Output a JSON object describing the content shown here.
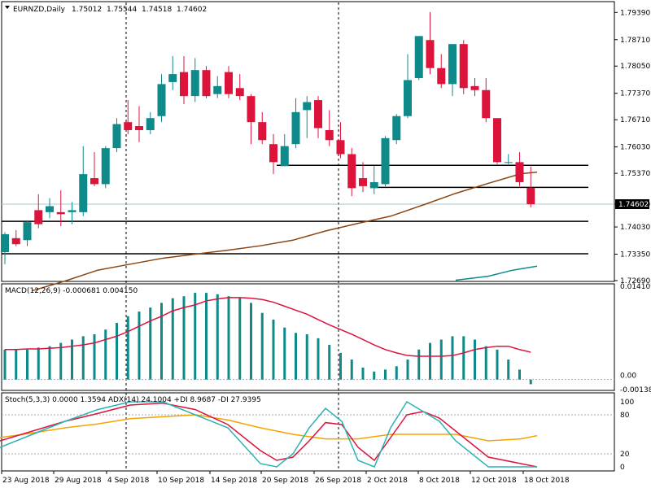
{
  "chart_data": {
    "type": "candlestick",
    "title": "EURNZD,Daily",
    "ohlc": [
      "1.75012",
      "1.75544",
      "1.74518",
      "1.74602"
    ],
    "current_price": "1.74602",
    "price_ylim": [
      1.7269,
      1.7964
    ],
    "price_ticks": [
      "1.79390",
      "1.78710",
      "1.78050",
      "1.77370",
      "1.76710",
      "1.76030",
      "1.75370",
      "1.74600",
      "1.74030",
      "1.73350",
      "1.72690"
    ],
    "candles": [
      {
        "o": 1.734,
        "h": 1.739,
        "l": 1.731,
        "c": 1.7385
      },
      {
        "o": 1.7375,
        "h": 1.7395,
        "l": 1.7355,
        "c": 1.736
      },
      {
        "o": 1.737,
        "h": 1.742,
        "l": 1.7355,
        "c": 1.7415
      },
      {
        "o": 1.7445,
        "h": 1.7485,
        "l": 1.74,
        "c": 1.741
      },
      {
        "o": 1.744,
        "h": 1.7475,
        "l": 1.7425,
        "c": 1.7455
      },
      {
        "o": 1.744,
        "h": 1.7495,
        "l": 1.7405,
        "c": 1.7435
      },
      {
        "o": 1.744,
        "h": 1.7465,
        "l": 1.741,
        "c": 1.7445
      },
      {
        "o": 1.744,
        "h": 1.7605,
        "l": 1.743,
        "c": 1.7535
      },
      {
        "o": 1.7525,
        "h": 1.759,
        "l": 1.7505,
        "c": 1.751
      },
      {
        "o": 1.751,
        "h": 1.7605,
        "l": 1.75,
        "c": 1.76
      },
      {
        "o": 1.76,
        "h": 1.7675,
        "l": 1.759,
        "c": 1.766
      },
      {
        "o": 1.7665,
        "h": 1.772,
        "l": 1.7635,
        "c": 1.7645
      },
      {
        "o": 1.7655,
        "h": 1.7705,
        "l": 1.7615,
        "c": 1.7645
      },
      {
        "o": 1.7645,
        "h": 1.769,
        "l": 1.7635,
        "c": 1.7675
      },
      {
        "o": 1.768,
        "h": 1.7785,
        "l": 1.7665,
        "c": 1.776
      },
      {
        "o": 1.7765,
        "h": 1.783,
        "l": 1.7745,
        "c": 1.7785
      },
      {
        "o": 1.779,
        "h": 1.783,
        "l": 1.771,
        "c": 1.773
      },
      {
        "o": 1.773,
        "h": 1.7825,
        "l": 1.7715,
        "c": 1.7795
      },
      {
        "o": 1.7795,
        "h": 1.7805,
        "l": 1.7725,
        "c": 1.773
      },
      {
        "o": 1.7735,
        "h": 1.778,
        "l": 1.7725,
        "c": 1.7755
      },
      {
        "o": 1.779,
        "h": 1.7805,
        "l": 1.7725,
        "c": 1.7735
      },
      {
        "o": 1.775,
        "h": 1.7785,
        "l": 1.772,
        "c": 1.773
      },
      {
        "o": 1.773,
        "h": 1.7735,
        "l": 1.761,
        "c": 1.7665
      },
      {
        "o": 1.7665,
        "h": 1.769,
        "l": 1.761,
        "c": 1.762
      },
      {
        "o": 1.761,
        "h": 1.7635,
        "l": 1.7535,
        "c": 1.7565
      },
      {
        "o": 1.7555,
        "h": 1.7635,
        "l": 1.7555,
        "c": 1.7605
      },
      {
        "o": 1.761,
        "h": 1.7725,
        "l": 1.76,
        "c": 1.769
      },
      {
        "o": 1.7695,
        "h": 1.773,
        "l": 1.7625,
        "c": 1.7715
      },
      {
        "o": 1.772,
        "h": 1.773,
        "l": 1.7625,
        "c": 1.765
      },
      {
        "o": 1.7645,
        "h": 1.7695,
        "l": 1.7605,
        "c": 1.762
      },
      {
        "o": 1.762,
        "h": 1.7665,
        "l": 1.7575,
        "c": 1.7585
      },
      {
        "o": 1.7585,
        "h": 1.76,
        "l": 1.748,
        "c": 1.75
      },
      {
        "o": 1.7525,
        "h": 1.7565,
        "l": 1.749,
        "c": 1.7505
      },
      {
        "o": 1.75,
        "h": 1.7555,
        "l": 1.7485,
        "c": 1.7515
      },
      {
        "o": 1.751,
        "h": 1.763,
        "l": 1.7505,
        "c": 1.7625
      },
      {
        "o": 1.762,
        "h": 1.7685,
        "l": 1.761,
        "c": 1.768
      },
      {
        "o": 1.768,
        "h": 1.7835,
        "l": 1.7675,
        "c": 1.777
      },
      {
        "o": 1.7775,
        "h": 1.788,
        "l": 1.777,
        "c": 1.788
      },
      {
        "o": 1.787,
        "h": 1.794,
        "l": 1.7785,
        "c": 1.78
      },
      {
        "o": 1.78,
        "h": 1.7835,
        "l": 1.775,
        "c": 1.776
      },
      {
        "o": 1.776,
        "h": 1.7825,
        "l": 1.773,
        "c": 1.786
      },
      {
        "o": 1.786,
        "h": 1.787,
        "l": 1.7735,
        "c": 1.775
      },
      {
        "o": 1.7755,
        "h": 1.7775,
        "l": 1.773,
        "c": 1.7745
      },
      {
        "o": 1.7745,
        "h": 1.7775,
        "l": 1.7665,
        "c": 1.7675
      },
      {
        "o": 1.7675,
        "h": 1.7675,
        "l": 1.756,
        "c": 1.7565
      },
      {
        "o": 1.7565,
        "h": 1.7585,
        "l": 1.756,
        "c": 1.7565
      },
      {
        "o": 1.7565,
        "h": 1.759,
        "l": 1.7505,
        "c": 1.7515
      },
      {
        "o": 1.7501,
        "h": 1.7554,
        "l": 1.7452,
        "c": 1.746
      }
    ],
    "ma_series": [
      [
        40,
        1.7244
      ],
      [
        80,
        1.7268
      ],
      [
        120,
        1.7295
      ],
      [
        160,
        1.731
      ],
      [
        200,
        1.7325
      ],
      [
        240,
        1.7335
      ],
      [
        280,
        1.7345
      ],
      [
        320,
        1.7356
      ],
      [
        360,
        1.737
      ],
      [
        400,
        1.7393
      ],
      [
        440,
        1.7412
      ],
      [
        480,
        1.743
      ],
      [
        520,
        1.7458
      ],
      [
        560,
        1.7487
      ],
      [
        600,
        1.7512
      ],
      [
        640,
        1.7536
      ],
      [
        660,
        1.754
      ]
    ],
    "ma2_series": [
      [
        560,
        1.727
      ],
      [
        600,
        1.728
      ],
      [
        630,
        1.7295
      ],
      [
        660,
        1.7305
      ]
    ],
    "hlines": [
      1.7557,
      1.7502,
      1.7417,
      1.7336
    ],
    "vlines_idx": [
      5,
      24
    ],
    "x_labels": [
      "23 Aug 2018",
      "29 Aug 2018",
      "4 Sep 2018",
      "10 Sep 2018",
      "14 Sep 2018",
      "20 Sep 2018",
      "26 Sep 2018",
      "2 Oct 2018",
      "8 Oct 2018",
      "12 Oct 2018",
      "18 Oct 2018"
    ],
    "macd": {
      "label": "MACD(12,26,9) -0.000681 0.004150",
      "ylim": [
        -0.00138,
        0.014109
      ],
      "ticks": [
        "0.014109",
        "0.00",
        "-0.00138"
      ],
      "hist": [
        0.0045,
        0.0045,
        0.0045,
        0.0048,
        0.005,
        0.0055,
        0.006,
        0.0065,
        0.0068,
        0.0075,
        0.0085,
        0.0095,
        0.0102,
        0.0108,
        0.0115,
        0.0122,
        0.0125,
        0.013,
        0.013,
        0.0128,
        0.0125,
        0.0123,
        0.0115,
        0.01,
        0.009,
        0.0078,
        0.007,
        0.0068,
        0.0062,
        0.0052,
        0.004,
        0.003,
        0.0018,
        0.0012,
        0.0015,
        0.002,
        0.003,
        0.0045,
        0.0055,
        0.006,
        0.0065,
        0.0065,
        0.006,
        0.005,
        0.0045,
        0.003,
        0.0015,
        -0.0007
      ],
      "signal": [
        0.0045,
        0.0045,
        0.0046,
        0.0046,
        0.0047,
        0.0048,
        0.005,
        0.0052,
        0.0055,
        0.006,
        0.0065,
        0.0072,
        0.008,
        0.0088,
        0.0095,
        0.0103,
        0.0108,
        0.0112,
        0.0118,
        0.0121,
        0.0123,
        0.0123,
        0.0122,
        0.012,
        0.0116,
        0.011,
        0.0104,
        0.0098,
        0.009,
        0.0082,
        0.0075,
        0.0068,
        0.006,
        0.0052,
        0.0045,
        0.004,
        0.0036,
        0.0035,
        0.0035,
        0.0035,
        0.0036,
        0.004,
        0.0045,
        0.0048,
        0.005,
        0.005,
        0.0045,
        0.0041
      ]
    },
    "stoch": {
      "label": "Stoch(5,3,3) 0.0000 1.3594 ADX(14) 24.1004 +DI 8.9687 -DI 27.9395",
      "ylim": [
        -5,
        110
      ],
      "ticks": [
        "100",
        "80",
        "20",
        "0"
      ],
      "main": [
        [
          0,
          30
        ],
        [
          40,
          50
        ],
        [
          80,
          70
        ],
        [
          120,
          88
        ],
        [
          160,
          100
        ],
        [
          200,
          100
        ],
        [
          240,
          80
        ],
        [
          280,
          60
        ],
        [
          320,
          5
        ],
        [
          340,
          0
        ],
        [
          360,
          20
        ],
        [
          380,
          60
        ],
        [
          400,
          90
        ],
        [
          420,
          70
        ],
        [
          440,
          10
        ],
        [
          460,
          0
        ],
        [
          480,
          60
        ],
        [
          500,
          100
        ],
        [
          520,
          85
        ],
        [
          540,
          70
        ],
        [
          560,
          40
        ],
        [
          600,
          0
        ],
        [
          660,
          0
        ]
      ],
      "signal": [
        [
          0,
          40
        ],
        [
          40,
          55
        ],
        [
          80,
          70
        ],
        [
          120,
          82
        ],
        [
          160,
          95
        ],
        [
          200,
          98
        ],
        [
          240,
          88
        ],
        [
          280,
          65
        ],
        [
          320,
          25
        ],
        [
          340,
          10
        ],
        [
          360,
          15
        ],
        [
          380,
          40
        ],
        [
          400,
          68
        ],
        [
          420,
          65
        ],
        [
          440,
          30
        ],
        [
          460,
          10
        ],
        [
          480,
          45
        ],
        [
          500,
          80
        ],
        [
          520,
          85
        ],
        [
          540,
          75
        ],
        [
          560,
          55
        ],
        [
          600,
          15
        ],
        [
          660,
          0
        ]
      ],
      "adx": [
        [
          0,
          45
        ],
        [
          40,
          52
        ],
        [
          80,
          60
        ],
        [
          120,
          66
        ],
        [
          160,
          74
        ],
        [
          200,
          77
        ],
        [
          240,
          80
        ],
        [
          280,
          72
        ],
        [
          320,
          60
        ],
        [
          360,
          50
        ],
        [
          400,
          43
        ],
        [
          440,
          43
        ],
        [
          480,
          50
        ],
        [
          520,
          50
        ],
        [
          560,
          50
        ],
        [
          600,
          40
        ],
        [
          640,
          43
        ],
        [
          660,
          48
        ]
      ]
    }
  }
}
